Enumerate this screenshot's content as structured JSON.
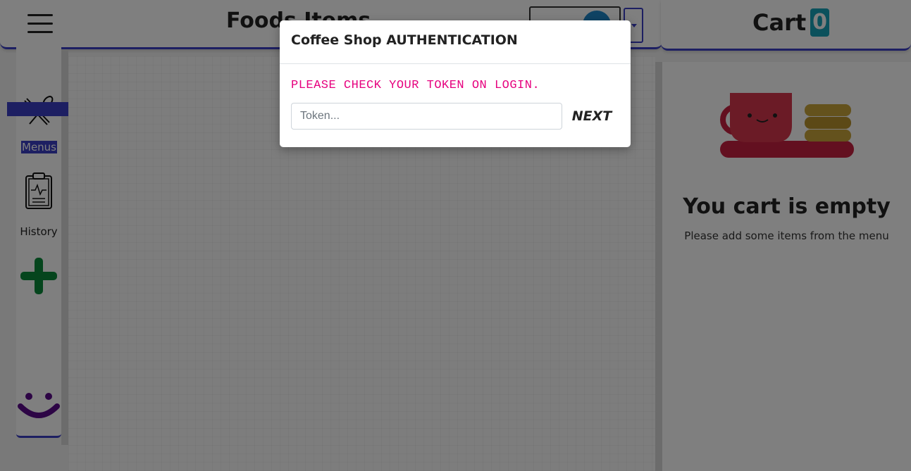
{
  "header": {
    "title": "Foods Items",
    "cart_label": "Cart",
    "cart_count": "0"
  },
  "sidebar": {
    "items": [
      {
        "label": "Menus",
        "icon": "fork-knife-icon",
        "active": true
      },
      {
        "label": "History",
        "icon": "clipboard-icon",
        "active": false
      },
      {
        "label": "",
        "icon": "plus-icon",
        "active": false
      }
    ],
    "logo_icon": "smile-logo-icon"
  },
  "cart": {
    "empty_title": "You cart is empty",
    "empty_subtitle": "Please add some items from the menu",
    "illustration_icon": "coffee-cup-illustration"
  },
  "modal": {
    "title": "Coffee Shop AUTHENTICATION",
    "message": "PLEASE CHECK YOUR TOKEN ON LOGIN.",
    "token_placeholder": "Token...",
    "token_value": "",
    "next_label": "NEXT"
  },
  "colors": {
    "accent": "#3a3fc4",
    "message": "#e6007e",
    "cart_badge": "#17a2b8",
    "plus": "#0a8a3a",
    "logo": "#5b0a8a",
    "cup": "#d7374d"
  }
}
